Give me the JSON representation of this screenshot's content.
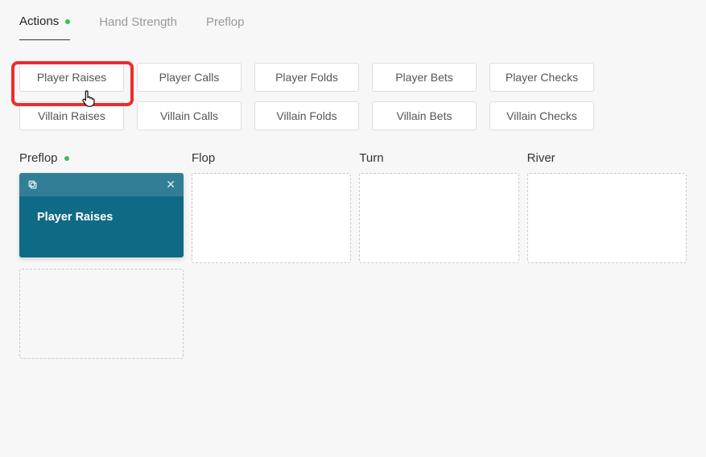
{
  "tabs": [
    {
      "label": "Actions",
      "active": true,
      "hasDot": true
    },
    {
      "label": "Hand Strength",
      "active": false,
      "hasDot": false
    },
    {
      "label": "Preflop",
      "active": false,
      "hasDot": false
    }
  ],
  "actionButtons": {
    "row1": [
      {
        "label": "Player Raises"
      },
      {
        "label": "Player Calls"
      },
      {
        "label": "Player Folds"
      },
      {
        "label": "Player Bets"
      },
      {
        "label": "Player Checks"
      }
    ],
    "row2": [
      {
        "label": "Villain Raises"
      },
      {
        "label": "Villain Calls"
      },
      {
        "label": "Villain Folds"
      },
      {
        "label": "Villain Bets"
      },
      {
        "label": "Villain Checks"
      }
    ]
  },
  "streets": [
    {
      "label": "Preflop",
      "hasDot": true
    },
    {
      "label": "Flop",
      "hasDot": false
    },
    {
      "label": "Turn",
      "hasDot": false
    },
    {
      "label": "River",
      "hasDot": false
    }
  ],
  "placedCard": {
    "title": "Player Raises"
  },
  "colors": {
    "accentGreen": "#3bbf4f",
    "cardTeal": "#0f6b85",
    "highlightRed": "#ee2b2b"
  }
}
